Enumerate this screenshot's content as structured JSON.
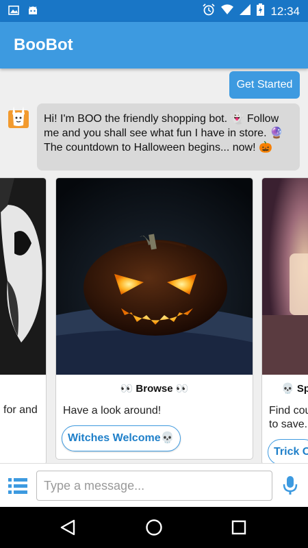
{
  "status_bar": {
    "time": "12:34"
  },
  "app": {
    "title": "BooBot"
  },
  "chat": {
    "get_started_label": "Get Started",
    "bot_message_line1": "Hi! I'm BOO the friendly shopping bot. 👻  Follow",
    "bot_message_line2": "me and you shall see what fun I have in store. 🔮",
    "bot_message_line3": "The countdown to Halloween begins... now! 🎃"
  },
  "carousel": {
    "left_card": {
      "desc": "for and"
    },
    "center_card": {
      "title": "👀 Browse 👀",
      "desc": "Have a look around!",
      "button": "Witches Welcome💀"
    },
    "right_card": {
      "title": "💀 Sp",
      "desc_line1": "Find cou",
      "desc_line2": "to save.",
      "button": "Trick O"
    }
  },
  "input": {
    "placeholder": "Type a message..."
  },
  "colors": {
    "primary": "#3d9ae0",
    "status": "#1976c6"
  }
}
